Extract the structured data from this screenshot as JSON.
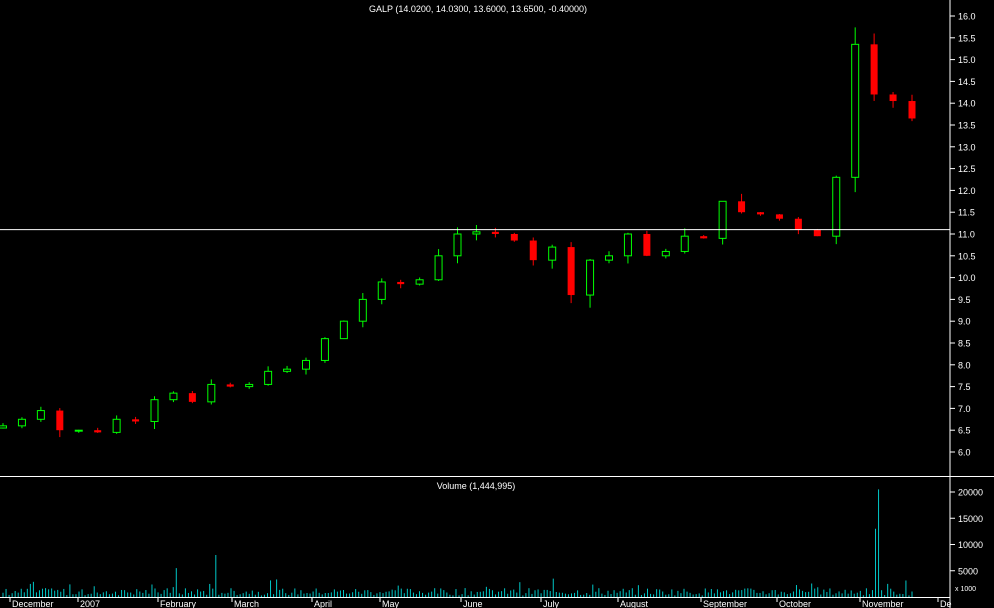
{
  "price_panel": {
    "title": "GALP (14.0200, 14.0300, 13.6000, 13.6500, -0.40000)"
  },
  "volume_panel": {
    "title": "Volume (1,444,995)",
    "scale_label": "x 1000"
  },
  "colors": {
    "background": "#000000",
    "up_candle": "#00ff00",
    "down_candle": "#ff0000",
    "volume_bar": "#00c8c8",
    "axis": "#ffffff",
    "reference_line": "#ffffff"
  },
  "chart_data": [
    {
      "type": "candlestick",
      "title": "GALP (14.0200, 14.0300, 13.6000, 13.6500, -0.40000)",
      "ylim": [
        5.4,
        16.2
      ],
      "y_ticks": [
        6.0,
        6.5,
        7.0,
        7.5,
        8.0,
        8.5,
        9.0,
        9.5,
        10.0,
        10.5,
        11.0,
        11.5,
        12.0,
        12.5,
        13.0,
        13.5,
        14.0,
        14.5,
        15.0,
        15.5,
        16.0
      ],
      "y_tick_labels": [
        "6.0",
        "6.5",
        "7.0",
        "7.5",
        "8.0",
        "8.5",
        "9.0",
        "9.5",
        "10.0",
        "10.5",
        "11.0",
        "11.5",
        "12.0",
        "12.5",
        "13.0",
        "13.5",
        "14.0",
        "14.5",
        "15.0",
        "15.5",
        "16.0"
      ],
      "reference_line": 11.1,
      "grid": false,
      "x_labels": [
        "December",
        "2007",
        "February",
        "March",
        "April",
        "May",
        "June",
        "July",
        "August",
        "September",
        "October",
        "November",
        "De"
      ],
      "series": [
        {
          "values": [
            {
              "x": "Dec 2006",
              "close": 6.6
            },
            {
              "x": "Dec 2006",
              "close": 6.75
            },
            {
              "x": "Jan 2007",
              "close": 6.95
            },
            {
              "x": "Jan 2007",
              "close": 6.5
            },
            {
              "x": "Jan 2007",
              "close": 6.5
            },
            {
              "x": "Feb 2007",
              "close": 6.45
            },
            {
              "x": "Feb 2007",
              "close": 6.75
            },
            {
              "x": "Feb 2007",
              "close": 6.7
            },
            {
              "x": "Mar 2007",
              "close": 7.2
            },
            {
              "x": "Mar 2007",
              "close": 7.35
            },
            {
              "x": "Mar 2007",
              "close": 7.15
            },
            {
              "x": "Mar 2007",
              "close": 7.55
            },
            {
              "x": "Apr 2007",
              "close": 7.5
            },
            {
              "x": "Apr 2007",
              "close": 7.55
            },
            {
              "x": "May 2007",
              "close": 7.85
            },
            {
              "x": "May 2007",
              "close": 7.9
            },
            {
              "x": "May 2007",
              "close": 8.1
            },
            {
              "x": "May 2007",
              "close": 8.6
            },
            {
              "x": "Jun 2007",
              "close": 9.0
            },
            {
              "x": "Jun 2007",
              "close": 9.5
            },
            {
              "x": "Jun 2007",
              "close": 9.9
            },
            {
              "x": "Jun 2007",
              "close": 9.85
            },
            {
              "x": "Jun 2007",
              "close": 9.95
            },
            {
              "x": "Jul 2007",
              "close": 10.5
            },
            {
              "x": "Jul 2007",
              "close": 11.0
            },
            {
              "x": "Jul 2007",
              "close": 11.05
            },
            {
              "x": "Jul 2007",
              "close": 11.0
            },
            {
              "x": "Jul 2007",
              "close": 10.85
            },
            {
              "x": "Aug 2007",
              "close": 10.4
            },
            {
              "x": "Aug 2007",
              "close": 10.7
            },
            {
              "x": "Aug 2007",
              "close": 9.6
            },
            {
              "x": "Aug 2007",
              "close": 10.4
            },
            {
              "x": "Aug 2007",
              "close": 10.5
            },
            {
              "x": "Sep 2007",
              "close": 11.0
            },
            {
              "x": "Sep 2007",
              "close": 10.5
            },
            {
              "x": "Sep 2007",
              "close": 10.6
            },
            {
              "x": "Sep 2007",
              "close": 10.95
            },
            {
              "x": "Sep 2007",
              "close": 10.9
            },
            {
              "x": "Oct 2007",
              "close": 11.75
            },
            {
              "x": "Oct 2007",
              "close": 11.5
            },
            {
              "x": "Oct 2007",
              "close": 11.45
            },
            {
              "x": "Oct 2007",
              "close": 11.35
            },
            {
              "x": "Nov 2007",
              "close": 11.1
            },
            {
              "x": "Nov 2007",
              "close": 10.95
            },
            {
              "x": "Nov 2007",
              "close": 12.3
            },
            {
              "x": "Nov 2007",
              "close": 15.35
            },
            {
              "x": "Nov 2007",
              "close": 14.2
            },
            {
              "x": "Nov 2007",
              "close": 14.05
            },
            {
              "x": "Nov 2007",
              "close": 13.65
            }
          ]
        }
      ]
    },
    {
      "type": "bar",
      "title": "Volume (1,444,995)",
      "ylabel": "x 1000",
      "ylim": [
        0,
        22000
      ],
      "y_ticks": [
        5000,
        10000,
        15000,
        20000
      ],
      "y_tick_labels": [
        "5000",
        "10000",
        "15000",
        "20000"
      ],
      "notable_values": [
        {
          "x": "Feb 2007",
          "value": 5500
        },
        {
          "x": "Mar 2007",
          "value": 8000
        },
        {
          "x": "Jul 2007",
          "value": 3500
        },
        {
          "x": "Nov 2007",
          "value": 13000
        },
        {
          "x": "Nov 2007",
          "value": 20500
        },
        {
          "x": "Nov 2007",
          "value": 2500
        }
      ]
    }
  ]
}
